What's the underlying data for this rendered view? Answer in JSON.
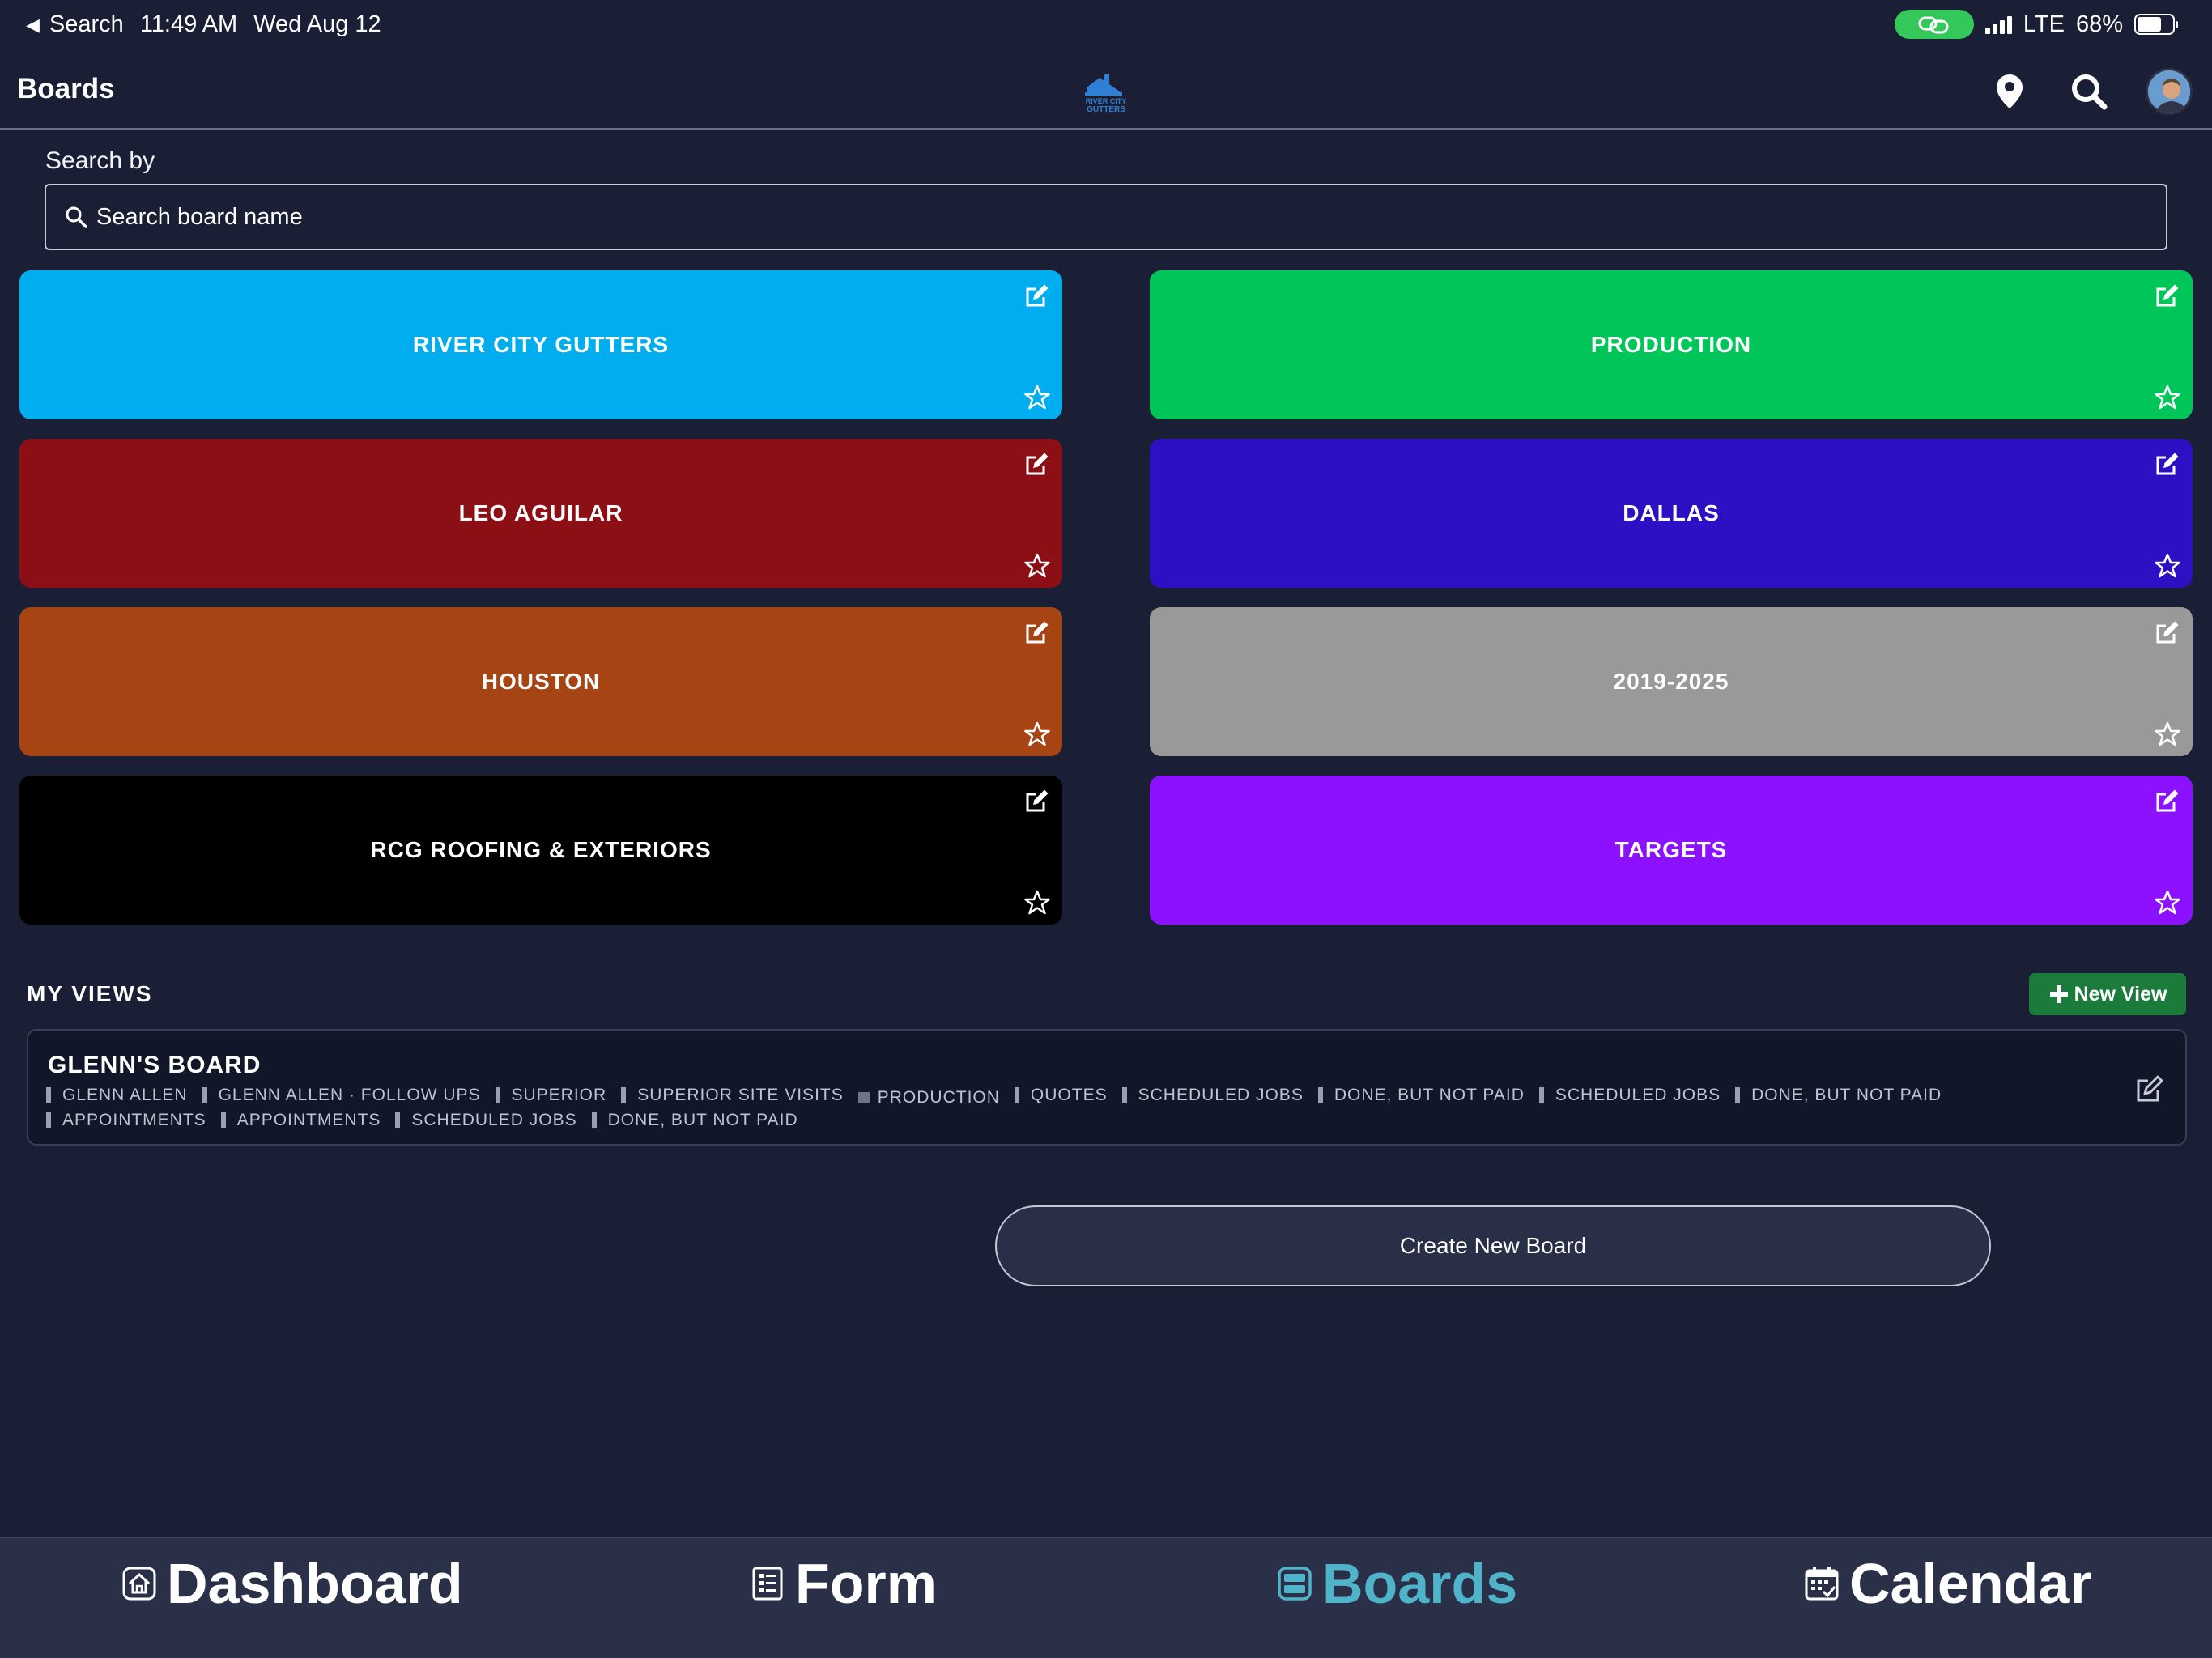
{
  "status_bar": {
    "back_label": "Search",
    "time": "11:49 AM",
    "date": "Wed Aug 12",
    "carrier": "LTE",
    "battery": "68%",
    "battery_level": 0.68
  },
  "header": {
    "title": "Boards",
    "logo_text_line1": "RIVER CITY",
    "logo_text_line2": "GUTTERS"
  },
  "search": {
    "label": "Search by",
    "placeholder": "Search board name",
    "value": ""
  },
  "boards": [
    {
      "name": "RIVER CITY GUTTERS",
      "color": "#00aeef"
    },
    {
      "name": "PRODUCTION",
      "color": "#00c65a"
    },
    {
      "name": "LEO AGUILAR",
      "color": "#8b0f14"
    },
    {
      "name": "DALLAS",
      "color": "#2d10c4"
    },
    {
      "name": "HOUSTON",
      "color": "#a74413"
    },
    {
      "name": "2019-2025",
      "color": "#999999"
    },
    {
      "name": "RCG ROOFING & EXTERIORS",
      "color": "#000000"
    },
    {
      "name": "TARGETS",
      "color": "#8b11ff"
    }
  ],
  "my_views": {
    "heading": "MY VIEWS",
    "new_view_label": "New View",
    "views": [
      {
        "name": "GLENN'S BOARD",
        "tags": [
          "GLENN ALLEN",
          "GLENN ALLEN · FOLLOW UPS",
          "SUPERIOR",
          "SUPERIOR SITE VISITS",
          "PRODUCTION",
          "QUOTES",
          "SCHEDULED JOBS",
          "DONE, BUT NOT PAID",
          "SCHEDULED JOBS",
          "DONE, BUT NOT PAID",
          "APPOINTMENTS",
          "APPOINTMENTS",
          "SCHEDULED JOBS",
          "DONE, BUT NOT PAID"
        ]
      }
    ]
  },
  "create_board_label": "Create New Board",
  "tabs": [
    {
      "label": "Dashboard",
      "icon": "home-icon"
    },
    {
      "label": "Form",
      "icon": "form-icon"
    },
    {
      "label": "Boards",
      "icon": "boards-icon",
      "active": true
    },
    {
      "label": "Calendar",
      "icon": "calendar-icon"
    }
  ],
  "colors": {
    "background": "#1b1f36",
    "accent": "#4fb3c9",
    "new_view": "#1b7b3b",
    "link_pill": "#34c759"
  }
}
